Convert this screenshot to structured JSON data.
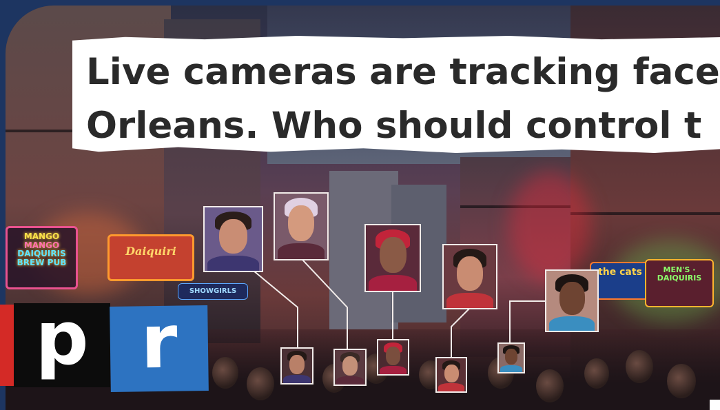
{
  "headline": {
    "line1": "Live cameras are tracking face",
    "line2": "Orleans. Who should control t"
  },
  "logo": {
    "letter_p": "p",
    "letter_r": "r"
  },
  "signs": {
    "mango_line1": "MANGO",
    "mango_line2": "MANGO",
    "mango_line3": "DAIQUIRIS",
    "mango_line4": "BREW PUB",
    "daiquiri": "Daiquiri",
    "showgirls": "SHOWGIRLS",
    "cats": "the cats",
    "right_sign": "MEN'S · DAIQUIRIS"
  },
  "colors": {
    "frame": "#1d3561",
    "npr_red": "#d42a26",
    "npr_black": "#0c0c0c",
    "npr_blue": "#2d73c1",
    "box_stroke": "#f2ecea"
  }
}
